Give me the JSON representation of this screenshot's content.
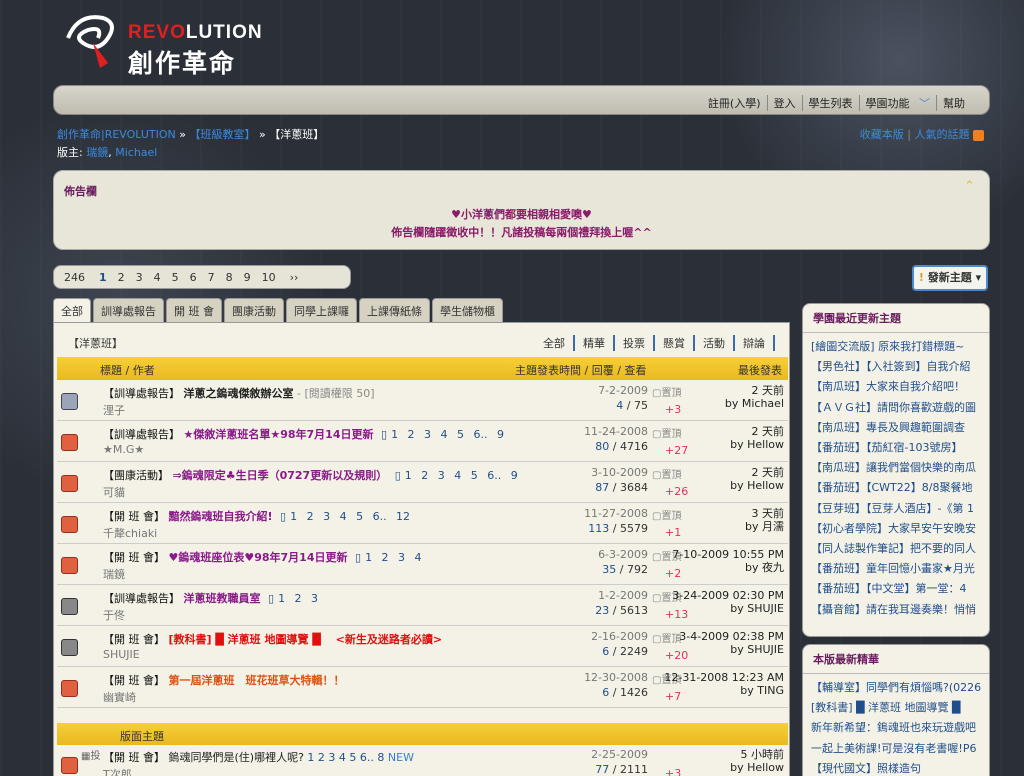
{
  "brand": {
    "en_red": "REVO",
    "en_rest": "LUTION",
    "zh": "創作革命"
  },
  "nav": [
    "註冊(入學)",
    "登入",
    "學生列表",
    "學園功能",
    "幫助"
  ],
  "breadcrumb": {
    "home": "創作革命|REVOLUTION",
    "sep1": "»",
    "cat": "【班級教室】",
    "sep2": "»",
    "cur": "【洋蔥班】"
  },
  "mods": {
    "label": "版主:",
    "m1": "瑞鏡",
    "m2": "Michael"
  },
  "toolbar": {
    "fav": "收藏本版",
    "read": "人氣的話題"
  },
  "notice": {
    "title": "佈告欄",
    "line1": "♥小洋蔥們都要相親相愛噢♥",
    "line2": "佈告欄隨躍徵收中！！凡諸投稿每兩個禮拜換上喔^^"
  },
  "pager": {
    "total": "246",
    "pages": [
      "1",
      "2",
      "3",
      "4",
      "5",
      "6",
      "7",
      "8",
      "9",
      "10"
    ],
    "next": "››",
    "current": "1"
  },
  "newthread": "發新主題",
  "tabs": [
    "全部",
    "訓導處報告",
    "開 班 會",
    "團康活動",
    "同學上課囉",
    "上課傳紙條",
    "學生儲物櫃"
  ],
  "forum_title": "【洋蔥班】",
  "filters": [
    "全部",
    "精華",
    "投票",
    "懸賞",
    "活動",
    "辯論"
  ],
  "thead": {
    "title": "標題 / 作者",
    "time": "主題發表時間 / 回覆 / 查看",
    "last": "最後發表"
  },
  "threads": [
    {
      "icon": "mid",
      "tag": "【訓導處報告】",
      "title": "洋蔥之鎢魂傑敘辦公室",
      "extra": " - [閱讀權限 50]",
      "color": "#222",
      "author": "浬子",
      "date": "7-2-2009",
      "replies": "4",
      "views": "75",
      "vote": "+3",
      "last1": "2 天前",
      "last2": "by Michael",
      "pages": ""
    },
    {
      "icon": "hot",
      "tag": "【訓導處報告】",
      "title": "★傑敘洋蔥班名單★98年7月14日更新",
      "extra": "",
      "color": "#8a1a8a",
      "author": "★M.G★",
      "date": "11-24-2008",
      "replies": "80",
      "views": "4716",
      "vote": "+27",
      "last1": "2 天前",
      "last2": "by Hellow",
      "pages": "1 2 3 4 5 6.. 9"
    },
    {
      "icon": "hot",
      "tag": "【團康活動】",
      "title": "⇒鎢魂限定♣生日季（0727更新以及規則）",
      "extra": "",
      "color": "#8a1a8a",
      "author": "可貓",
      "date": "3-10-2009",
      "replies": "87",
      "views": "3684",
      "vote": "+26",
      "last1": "2 天前",
      "last2": "by Hellow",
      "pages": "1 2 3 4 5 6.. 9"
    },
    {
      "icon": "hot",
      "tag": "【開 班 會】",
      "title": "黯然鎢魂班自我介紹!",
      "extra": "",
      "color": "#8a1a8a",
      "author": "千犛chiaki",
      "date": "11-27-2008",
      "replies": "113",
      "views": "5579",
      "vote": "+1",
      "last1": "3 天前",
      "last2": "by 月濡",
      "pages": "1 2 3 4 5 6.. 12"
    },
    {
      "icon": "hot",
      "tag": "【開 班 會】",
      "title": "♥鎢魂班座位表♥98年7月14日更新",
      "extra": "",
      "color": "#8a1a8a",
      "author": "瑞鏡",
      "date": "6-3-2009",
      "replies": "35",
      "views": "792",
      "vote": "+2",
      "last1": "7-10-2009 10:55 PM",
      "last2": "by 夜九",
      "pages": "1 2 3 4"
    },
    {
      "icon": "cls",
      "tag": "【訓導處報告】",
      "title": "洋蔥班教職員室",
      "extra": "",
      "color": "#8a1a8a",
      "author": "于佟",
      "date": "1-2-2009",
      "replies": "23",
      "views": "5613",
      "vote": "+13",
      "last1": "3-24-2009 02:30 PM",
      "last2": "by SHUJIE",
      "pages": "1 2 3"
    },
    {
      "icon": "cls",
      "tag": "【開 班 會】",
      "title": "[教科書] █ 洋蔥班 地圖導覽 █ 　<新生及迷路者必讀>",
      "extra": "",
      "color": "#e01010",
      "author": "SHUJIE",
      "date": "2-16-2009",
      "replies": "6",
      "views": "2249",
      "vote": "+20",
      "last1": "3-4-2009 02:38 PM",
      "last2": "by SHUJIE",
      "pages": ""
    },
    {
      "icon": "hot",
      "tag": "【開 班 會】",
      "title": "第一屆洋蔥班　班花班草大特輯！！",
      "extra": "",
      "color": "#e05010",
      "author": "幽實崎",
      "date": "12-30-2008",
      "replies": "6",
      "views": "1426",
      "vote": "+7",
      "last1": "12-31-2008 12:23 AM",
      "last2": "by TING",
      "pages": ""
    }
  ],
  "subheader": "版面主題",
  "last_thread": {
    "tag": "【開 班 會】",
    "title": "鎢魂同學們是(住)哪裡人呢?",
    "pages": "1 2 3 4 5 6.. 8",
    "new": "NEW",
    "author": "T次郎",
    "date": "2-25-2009",
    "replies": "77",
    "views": "2111",
    "vote": "+3",
    "last1": "5 小時前",
    "last2": "by Hellow"
  },
  "side1": {
    "title": "學園最近更新主題",
    "items": [
      "[繪圖交流版] 原來我打錯標題~",
      "【男色社】【入社簽到】自我介紹",
      "【南瓜班】大家來自我介紹吧！",
      "【ＡＶＧ社】請問你喜歡遊戲的圖",
      "【南瓜班】專長及興趣範圍調查",
      "【番茄班】【茄紅宿-103號房】",
      "【南瓜班】讓我們當個快樂的南瓜",
      "【番茄班】【CWT22】8/8聚餐地",
      "【豆芽班】【豆芽人酒店】-《第 1",
      "【初心者學院】大家早安午安晚安",
      "【同人誌製作筆記】把不要的同人",
      "【番茄班】童年回憶小畫家★月光",
      "【番茄班】【中文堂】第一堂：4",
      "【攝音館】請在我耳邊奏樂！悄悄"
    ]
  },
  "side2": {
    "title": "本版最新精華",
    "items": [
      "【輔導室】同學們有煩惱嗎?(0226",
      "[教科書] █ 洋蔥班 地圖導覽 █",
      "新年新希望：鎢魂班也來玩遊戲吧",
      "一起上美術課!可是沒有老書喔!P6",
      "【現代國文】照樣造句"
    ]
  }
}
